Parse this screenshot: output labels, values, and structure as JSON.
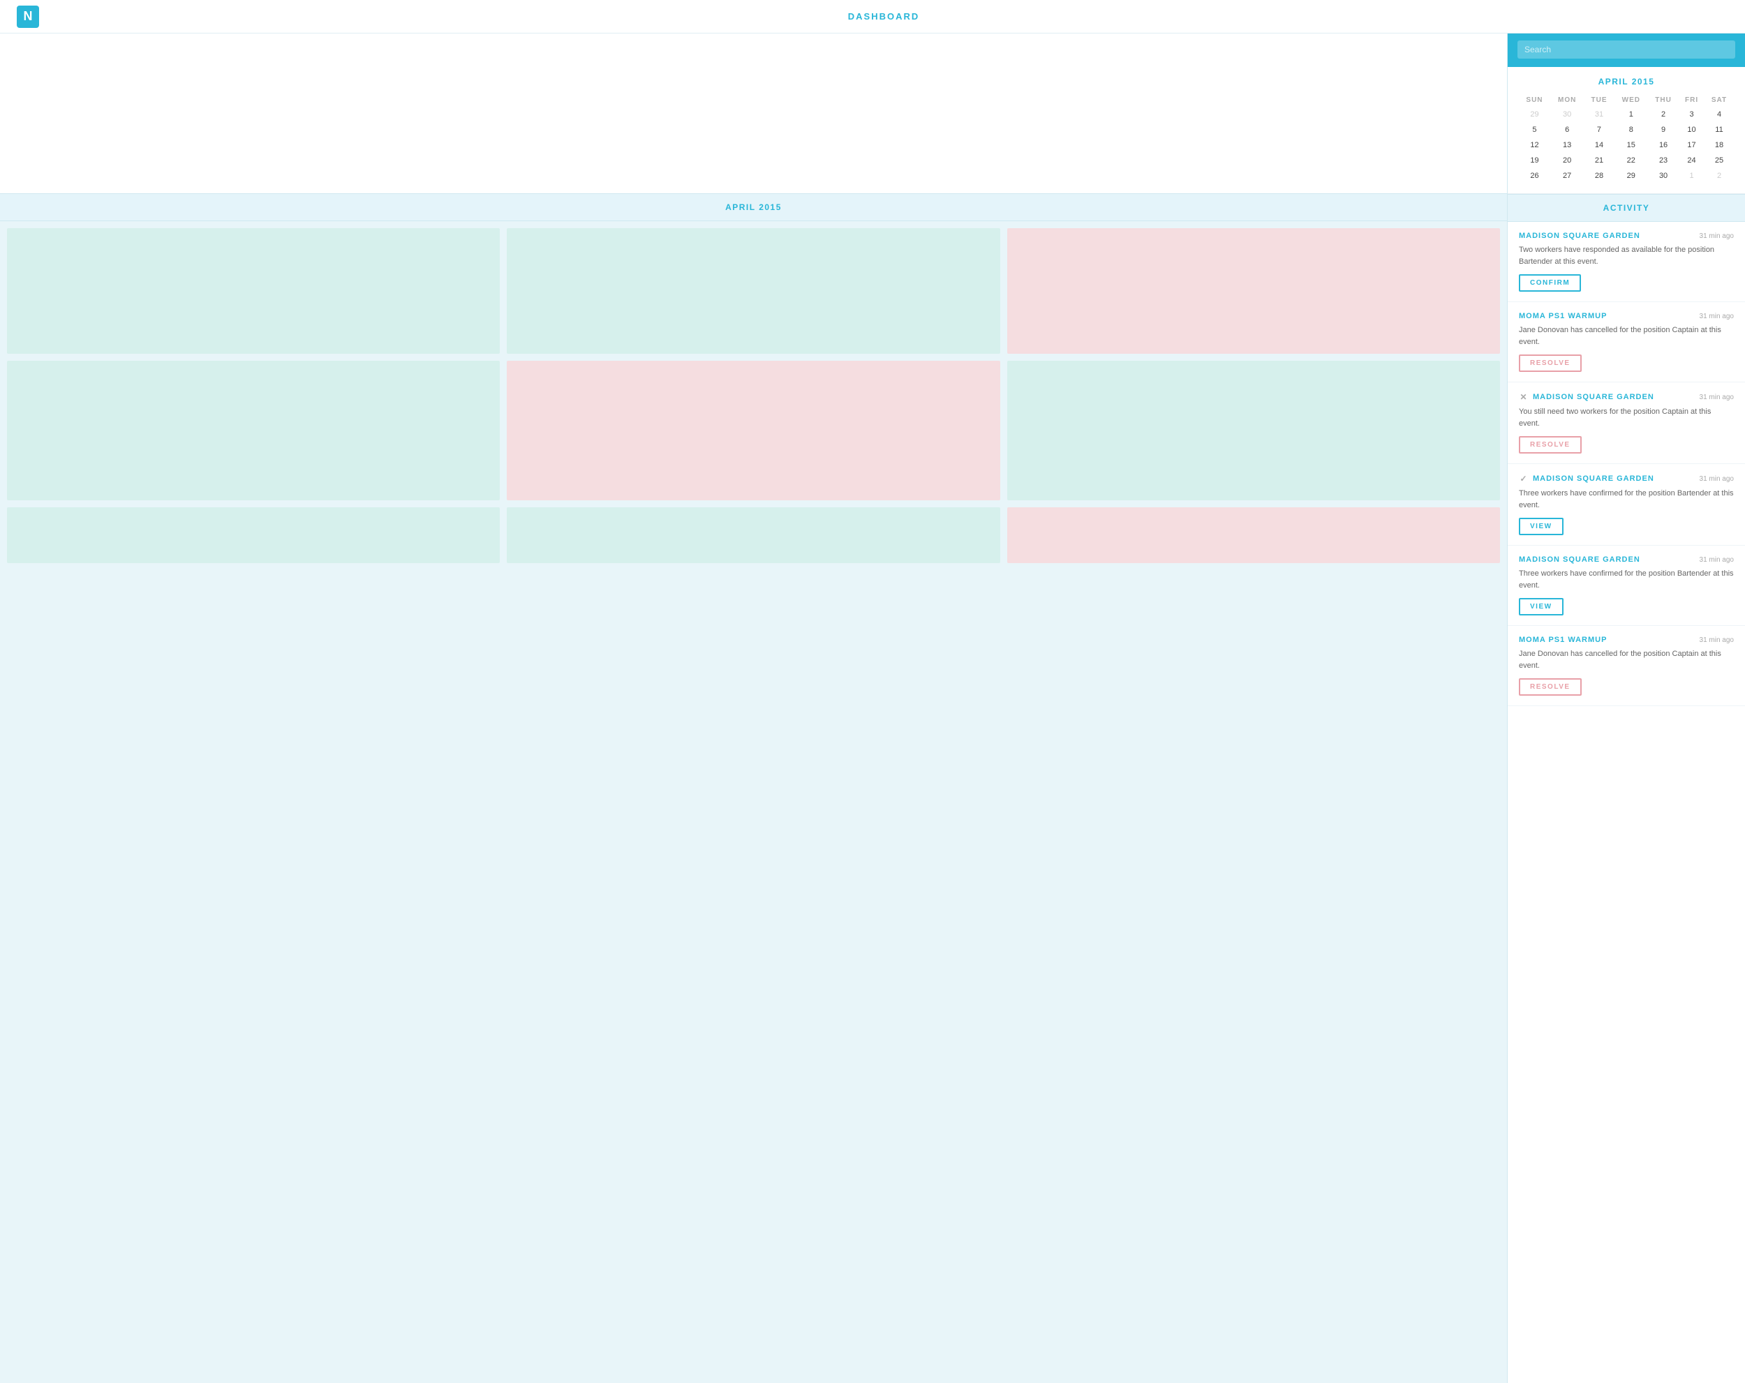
{
  "nav": {
    "logo_letter": "N",
    "title": "DASHBOARD"
  },
  "search": {
    "placeholder": "Search"
  },
  "calendar": {
    "title": "APRIL 2015",
    "days": [
      "SUN",
      "MON",
      "TUE",
      "WED",
      "THU",
      "FRI",
      "SAT"
    ],
    "weeks": [
      [
        {
          "d": "29",
          "other": true
        },
        {
          "d": "30",
          "other": true
        },
        {
          "d": "31",
          "other": true
        },
        {
          "d": "1"
        },
        {
          "d": "2"
        },
        {
          "d": "3"
        },
        {
          "d": "4"
        }
      ],
      [
        {
          "d": "5"
        },
        {
          "d": "6"
        },
        {
          "d": "7"
        },
        {
          "d": "8"
        },
        {
          "d": "9"
        },
        {
          "d": "10"
        },
        {
          "d": "11"
        }
      ],
      [
        {
          "d": "12"
        },
        {
          "d": "13"
        },
        {
          "d": "14"
        },
        {
          "d": "15"
        },
        {
          "d": "16"
        },
        {
          "d": "17"
        },
        {
          "d": "18"
        }
      ],
      [
        {
          "d": "19"
        },
        {
          "d": "20"
        },
        {
          "d": "21"
        },
        {
          "d": "22"
        },
        {
          "d": "23"
        },
        {
          "d": "24"
        },
        {
          "d": "25"
        }
      ],
      [
        {
          "d": "26"
        },
        {
          "d": "27"
        },
        {
          "d": "28"
        },
        {
          "d": "29"
        },
        {
          "d": "30"
        },
        {
          "d": "1",
          "other": true
        },
        {
          "d": "2",
          "other": true
        }
      ]
    ]
  },
  "sections": {
    "april_label": "APRIL 2015",
    "activity_label": "ACTIVITY"
  },
  "activity_items": [
    {
      "venue": "MADISON SQUARE GARDEN",
      "time": "31 min ago",
      "text": "Two workers have responded as available for the position Bartender at this event.",
      "button_type": "confirm",
      "button_label": "CONFIRM",
      "icon": "none"
    },
    {
      "venue": "MOMA PS1 WARMUP",
      "time": "31 min ago",
      "text": "Jane Donovan has cancelled for the position Captain at this event.",
      "button_type": "resolve",
      "button_label": "RESOLVE",
      "icon": "none"
    },
    {
      "venue": "MADISON SQUARE GARDEN",
      "time": "31 min ago",
      "text": "You still need two workers for the position Captain at this event.",
      "button_type": "resolve",
      "button_label": "RESOLVE",
      "icon": "x"
    },
    {
      "venue": "MADISON SQUARE GARDEN",
      "time": "31 min ago",
      "text": "Three workers have confirmed for the position Bartender at this event.",
      "button_type": "view",
      "button_label": "VIEW",
      "icon": "check"
    },
    {
      "venue": "MADISON SQUARE GARDEN",
      "time": "31 min ago",
      "text": "Three workers have confirmed for the position Bartender at this event.",
      "button_type": "view",
      "button_label": "VIEW",
      "icon": "none"
    },
    {
      "venue": "MOMA PS1 WARMUP",
      "time": "31 min ago",
      "text": "Jane Donovan has cancelled for the position Captain at this event.",
      "button_type": "resolve",
      "button_label": "RESOLVE",
      "icon": "none"
    }
  ]
}
